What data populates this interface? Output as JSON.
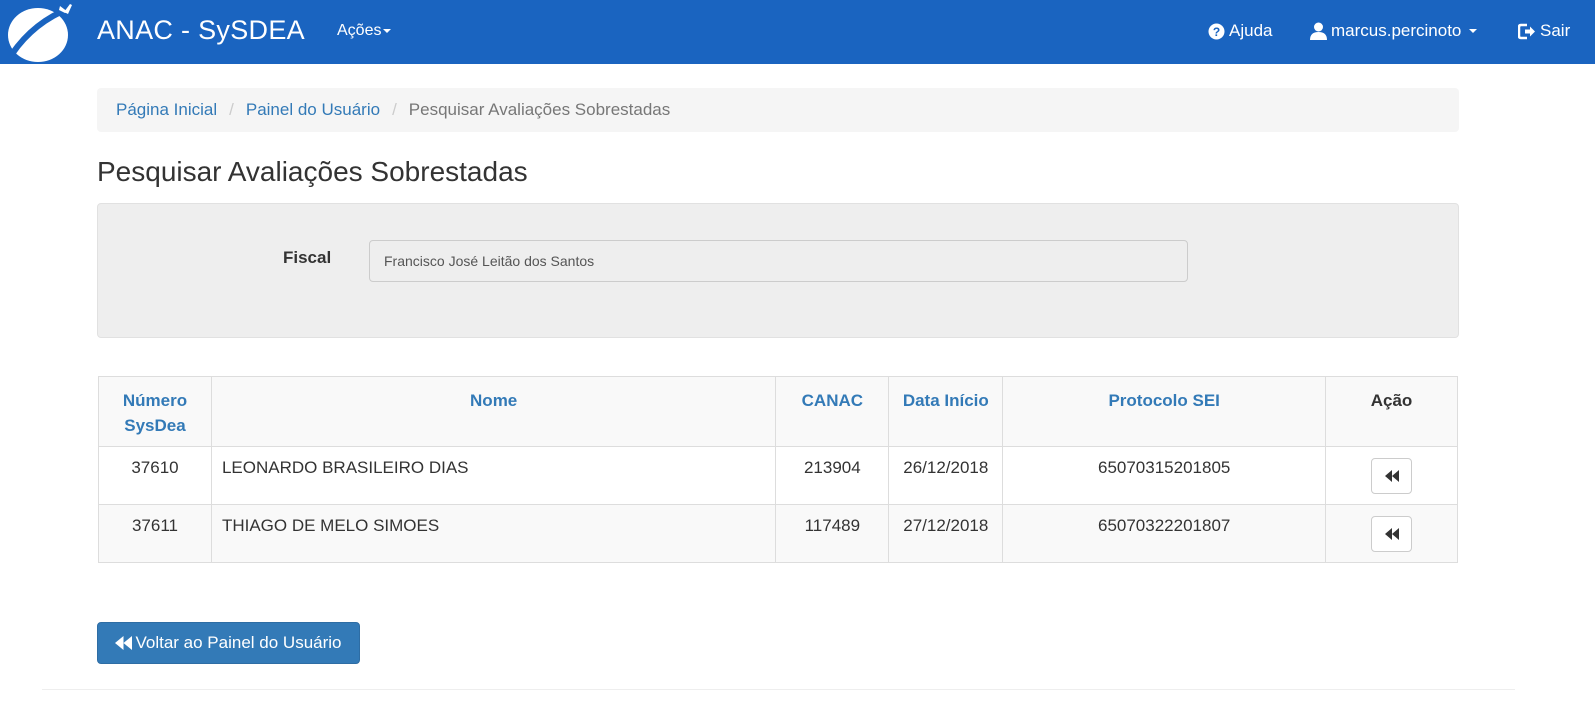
{
  "navbar": {
    "brand": "ANAC - SySDEA",
    "menu_acoes": "Ações",
    "help": "Ajuda",
    "user": "marcus.percinoto",
    "exit": "Sair",
    "color": "#1a64c0",
    "icons": {
      "logo": "anac-airplane-logo",
      "help": "question-circle-icon",
      "user": "user-icon",
      "exit": "logout-icon",
      "dropdown": "caret-down-icon"
    }
  },
  "breadcrumb": {
    "items": [
      "Página Inicial",
      "Painel do Usuário",
      "Pesquisar Avaliações Sobrestadas"
    ],
    "separator": "/"
  },
  "page": {
    "title": "Pesquisar Avaliações Sobrestadas"
  },
  "filter": {
    "fiscal_label": "Fiscal",
    "fiscal_value": "Francisco José Leitão dos Santos"
  },
  "table": {
    "columns": [
      "Número SysDea",
      "Nome",
      "CANAC",
      "Data Início",
      "Protocolo SEI",
      "Ação"
    ],
    "rows": [
      {
        "numero": "37610",
        "nome": "LEONARDO BRASILEIRO DIAS",
        "canac": "213904",
        "data_inicio": "26/12/2018",
        "protocolo": "65070315201805"
      },
      {
        "numero": "37611",
        "nome": "THIAGO DE MELO SIMOES",
        "canac": "117489",
        "data_inicio": "27/12/2018",
        "protocolo": "65070322201807"
      }
    ],
    "action_icon": "backward-icon"
  },
  "back_button": {
    "label": "Voltar ao Painel do Usuário",
    "icon": "backward-icon",
    "color": "#337ab7"
  }
}
